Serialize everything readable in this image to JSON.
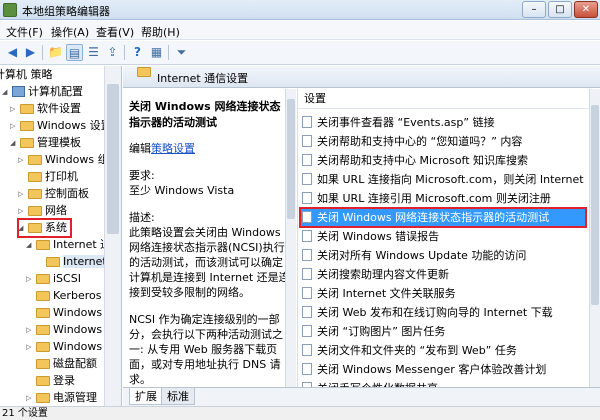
{
  "window": {
    "title": "本地组策略编辑器"
  },
  "menu": [
    "文件(F)",
    "操作(A)",
    "查看(V)",
    "帮助(H)"
  ],
  "tree": [
    {
      "label": "计算机 策略",
      "indent": 0
    },
    {
      "label": "计算机配置",
      "indent": 1
    },
    {
      "label": "软件设置",
      "indent": 2
    },
    {
      "label": "Windows 设置",
      "indent": 2
    },
    {
      "label": "管理模板",
      "indent": 2
    },
    {
      "label": "Windows 组件",
      "indent": 3
    },
    {
      "label": "打印机",
      "indent": 3
    },
    {
      "label": "控制面板",
      "indent": 3
    },
    {
      "label": "网络",
      "indent": 3
    },
    {
      "label": "系统",
      "indent": 3
    },
    {
      "label": "Internet 通",
      "indent": 4
    },
    {
      "label": "Internet",
      "indent": 5
    },
    {
      "label": "iSCSI",
      "indent": 4
    },
    {
      "label": "Kerberos",
      "indent": 4
    },
    {
      "label": "Windows 热",
      "indent": 4
    },
    {
      "label": "Windows 时",
      "indent": 4
    },
    {
      "label": "Windows 文",
      "indent": 4
    },
    {
      "label": "磁盘配额",
      "indent": 4
    },
    {
      "label": "登录",
      "indent": 4
    },
    {
      "label": "电源管理",
      "indent": 4
    }
  ],
  "header": {
    "title": "Internet 通信设置"
  },
  "description": {
    "title": "关闭 Windows 网络连接状态指示器的活动测试",
    "edit_prefix": "编辑",
    "edit_link": "策略设置",
    "req_label": "要求:",
    "req_value": "至少 Windows Vista",
    "desc_label": "描述:",
    "desc_text": "此策略设置会关闭由 Windows 网络连接状态指示器(NCSI)执行的活动测试，而该测试可以确定计算机是连接到 Internet 还是连接到受较多限制的网络。",
    "desc_text2": "NCSI 作为确定连接级别的一部分，会执行以下两种活动测试之一: 从专用 Web 服务器下载页面，或对专用地址执行 DNS 请求。"
  },
  "list": {
    "header": "设置",
    "items": [
      "关闭事件查看器 “Events.asp” 链接",
      "关闭帮助和支持中心的 “您知道吗？” 内容",
      "关闭帮助和支持中心 Microsoft 知识库搜索",
      "如果 URL 连接指向 Microsoft.com，则关闭 Internet 连接...",
      "如果 URL 连接引用 Microsoft.com 则关闭注册",
      "关闭 Windows 网络连接状态指示器的活动测试",
      "关闭 Windows 错误报告",
      "关闭对所有 Windows Update 功能的访问",
      "关闭搜索助理内容文件更新",
      "关闭 Internet 文件关联服务",
      "关闭 Web 发布和在线订购向导的 Internet 下载",
      "关闭 “订购图片” 图片任务",
      "关闭文件和文件夹的 “发布到 Web” 任务",
      "关闭 Windows Messenger 客户体验改善计划",
      "关闭手写个性化数据共享"
    ],
    "selected_index": 5
  },
  "tabs": [
    "扩展",
    "标准"
  ],
  "status": "21 个设置"
}
